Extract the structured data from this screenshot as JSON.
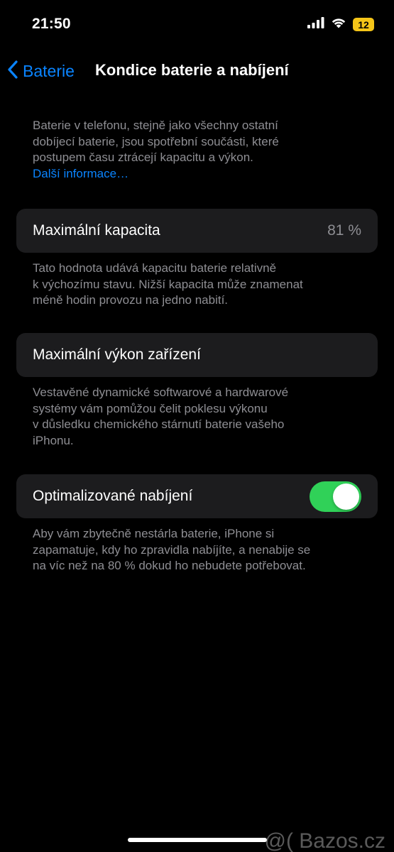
{
  "status_bar": {
    "time": "21:50",
    "battery_level": "12",
    "icons": [
      "signal-icon",
      "wifi-icon",
      "battery-icon"
    ],
    "battery_color": "#f5c518"
  },
  "nav": {
    "back_label": "Baterie",
    "title": "Kondice baterie a nabíjení",
    "accent_color": "#0a84ff"
  },
  "intro": {
    "lines": [
      "Baterie v telefonu, stejně jako všechny ostatní",
      "dobíjecí baterie, jsou spotřební součásti, které",
      "postupem času ztrácejí kapacitu a výkon."
    ],
    "link": "Další informace…"
  },
  "max_capacity": {
    "label": "Maximální kapacita",
    "value": "81 %",
    "footnote_lines": [
      "Tato hodnota udává kapacitu baterie relativně",
      "k výchozímu stavu. Nižší kapacita může znamenat",
      "méně hodin provozu na jedno nabití."
    ]
  },
  "max_performance": {
    "label": "Maximální výkon zařízení",
    "footnote_lines": [
      "Vestavěné dynamické softwarové a hardwarové",
      "systémy vám pomůžou čelit poklesu výkonu",
      "v důsledku chemického stárnutí baterie vašeho",
      "iPhonu."
    ]
  },
  "optimized_charging": {
    "label": "Optimalizované nabíjení",
    "enabled": true,
    "toggle_color": "#30d158",
    "footnote_lines": [
      "Aby vám zbytečně nestárla baterie, iPhone si",
      "zapamatuje, kdy ho zpravidla nabíjíte, a nenabije se",
      "na víc než na 80 % dokud ho nebudete potřebovat."
    ]
  },
  "watermark": "@( Bazos.cz"
}
